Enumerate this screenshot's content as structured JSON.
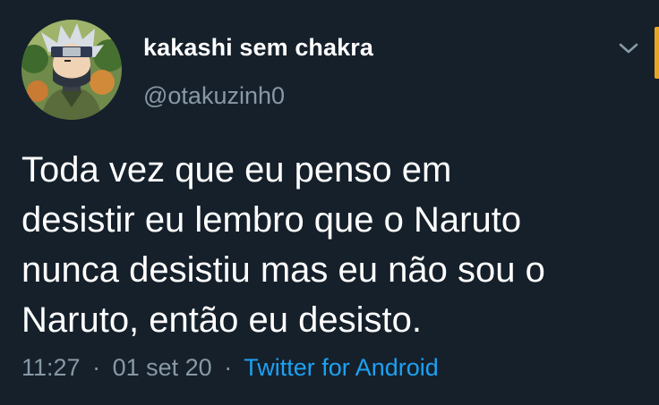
{
  "user": {
    "display_name": "kakashi sem chakra",
    "handle": "@otakuzinh0"
  },
  "tweet": {
    "text_lines": [
      "Toda vez que eu penso em",
      "desistir eu lembro que o Naruto",
      "nunca desistiu mas eu não sou o",
      "Naruto, então eu desisto."
    ],
    "time": "11:27",
    "date": "01 set 20",
    "separator": "·",
    "source": "Twitter for Android"
  },
  "colors": {
    "background": "#15202b",
    "text": "#ffffff",
    "secondary_text": "#8899a6",
    "link": "#1da1f2",
    "accent_strip": "#e6a623"
  },
  "icons": {
    "avatar": "kakashi-avatar",
    "menu": "chevron-down-icon"
  }
}
